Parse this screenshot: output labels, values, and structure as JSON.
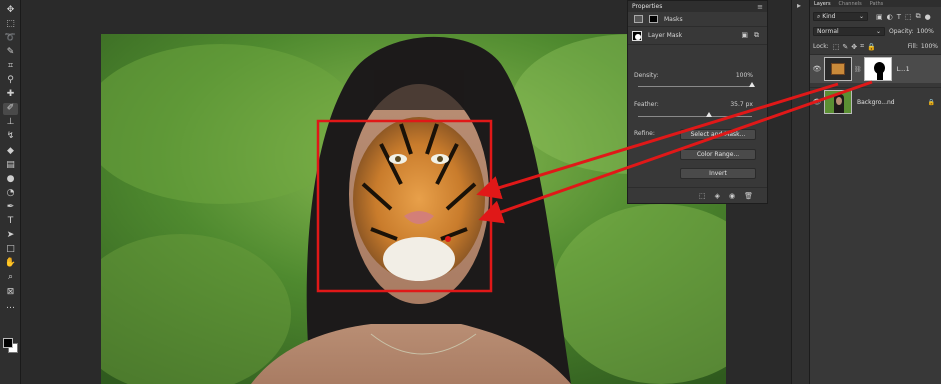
{
  "toolbar": {
    "tools": [
      {
        "name": "move-tool-icon",
        "glyph": "✥"
      },
      {
        "name": "marquee-tool-icon",
        "glyph": "⬚"
      },
      {
        "name": "lasso-tool-icon",
        "glyph": "➰"
      },
      {
        "name": "quick-select-tool-icon",
        "glyph": "✎"
      },
      {
        "name": "crop-tool-icon",
        "glyph": "⌗"
      },
      {
        "name": "eyedropper-tool-icon",
        "glyph": "⚲"
      },
      {
        "name": "healing-brush-icon",
        "glyph": "✚"
      },
      {
        "name": "brush-tool-icon",
        "glyph": "✐"
      },
      {
        "name": "clone-stamp-icon",
        "glyph": "⊥"
      },
      {
        "name": "history-brush-icon",
        "glyph": "↯"
      },
      {
        "name": "eraser-tool-icon",
        "glyph": "◆"
      },
      {
        "name": "gradient-tool-icon",
        "glyph": "▤"
      },
      {
        "name": "blur-tool-icon",
        "glyph": "●"
      },
      {
        "name": "dodge-tool-icon",
        "glyph": "◔"
      },
      {
        "name": "pen-tool-icon",
        "glyph": "✒"
      },
      {
        "name": "type-tool-icon",
        "glyph": "T"
      },
      {
        "name": "path-select-icon",
        "glyph": "➤"
      },
      {
        "name": "shape-tool-icon",
        "glyph": "□"
      },
      {
        "name": "hand-tool-icon",
        "glyph": "✋"
      },
      {
        "name": "zoom-tool-icon",
        "glyph": "⌕"
      },
      {
        "name": "edit-toolbar-icon",
        "glyph": "⊠"
      },
      {
        "name": "more-tools-icon",
        "glyph": "…"
      }
    ],
    "active_tool": "brush-tool-icon"
  },
  "properties": {
    "title": "Properties",
    "masks_label": "Masks",
    "layer_mask_label": "Layer Mask",
    "density_label": "Density:",
    "density_value": "100%",
    "density_fraction": 1.0,
    "feather_label": "Feather:",
    "feather_value": "35.7 px",
    "feather_fraction": 0.62,
    "refine_label": "Refine:",
    "select_and_mask": "Select and Mask...",
    "color_range": "Color Range...",
    "invert": "Invert"
  },
  "layers": {
    "tabs": [
      "Layers",
      "Channels",
      "Paths"
    ],
    "filter": "Kind",
    "blend_mode": "Normal",
    "opacity_label": "Opacity:",
    "opacity_value": "100%",
    "lock_label": "Lock:",
    "fill_label": "Fill:",
    "fill_value": "100%",
    "items": [
      {
        "name": "L...1",
        "selected": true
      },
      {
        "name": "Backgro...nd",
        "selected": false
      }
    ]
  },
  "colors": {
    "annotation_red": "#e01818",
    "panel_bg": "#383838",
    "app_bg": "#262626"
  }
}
